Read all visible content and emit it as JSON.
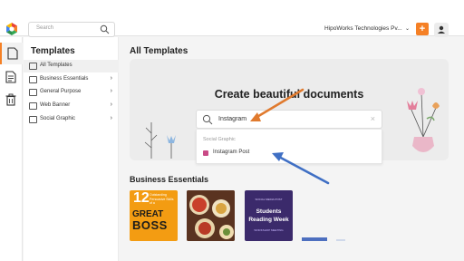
{
  "header": {
    "search_placeholder": "Search",
    "company": "HipoWorks Technologies Pv...",
    "create_label": "+",
    "accent": "#f58025"
  },
  "rail": {
    "items": [
      {
        "name": "document-icon",
        "active": true
      },
      {
        "name": "list-document-icon",
        "active": false
      },
      {
        "name": "trash-icon",
        "active": false
      }
    ]
  },
  "sidebar": {
    "title": "Templates",
    "items": [
      {
        "label": "All Templates",
        "active": true
      },
      {
        "label": "Business Essentials",
        "chevron": "›"
      },
      {
        "label": "General Purpose",
        "chevron": "›"
      },
      {
        "label": "Web Banner",
        "chevron": "›"
      },
      {
        "label": "Social Graphic",
        "chevron": "›"
      }
    ]
  },
  "main": {
    "title": "All Templates",
    "hero_title": "Create beautiful documents",
    "search": {
      "value": "Instagram",
      "clear": "×"
    },
    "dropdown": {
      "group": "Social Graphic",
      "option": "Instagram Post"
    },
    "section_title": "Business Essentials",
    "cards": {
      "card1": {
        "big": "12",
        "small": "Outstanding Persuasive Skills of a",
        "great": "GREAT",
        "boss": "BOSS"
      },
      "card3": {
        "tag": "SOCIAL MEDIA POST",
        "line1": "Students",
        "line2": "Reading Week",
        "meta": "WORKSHOP MEETING"
      }
    }
  },
  "annotations": {
    "arrow_color_orange": "#e07a2e",
    "arrow_color_blue": "#3f6fc4"
  }
}
